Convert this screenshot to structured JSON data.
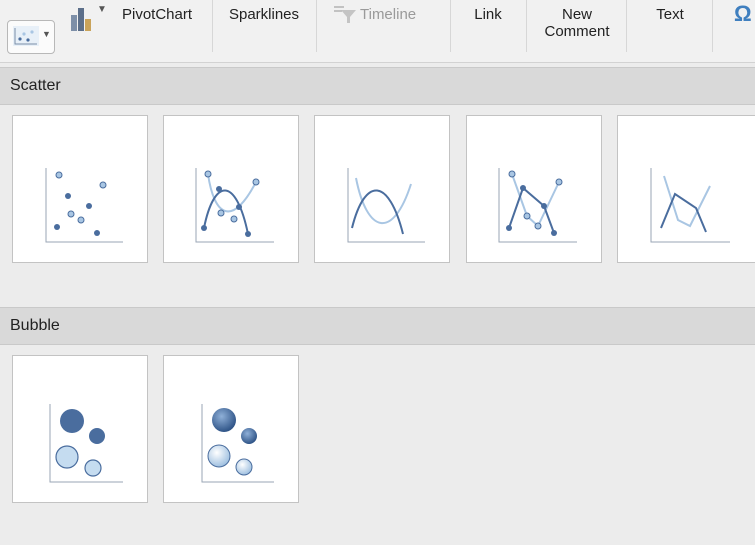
{
  "ribbon": {
    "pivotchart_label": "PivotChart",
    "sparklines_label": "Sparklines",
    "timeline_label": "Timeline",
    "link_label": "Link",
    "new_comment_line1": "New",
    "new_comment_line2": "Comment",
    "text_label": "Text"
  },
  "sections": {
    "scatter": {
      "title": "Scatter",
      "options": [
        {
          "icon": "scatter-markers-only-icon"
        },
        {
          "icon": "scatter-smooth-lines-markers-icon"
        },
        {
          "icon": "scatter-smooth-lines-icon"
        },
        {
          "icon": "scatter-straight-lines-markers-icon"
        },
        {
          "icon": "scatter-straight-lines-icon"
        }
      ]
    },
    "bubble": {
      "title": "Bubble",
      "options": [
        {
          "icon": "bubble-icon"
        },
        {
          "icon": "bubble-3d-icon"
        }
      ]
    }
  },
  "colors": {
    "accent_dark": "#4a6d9e",
    "accent_light": "#a9c6e3",
    "tile_bg": "#ffffff",
    "panel_bg": "#ececec",
    "header_bg": "#d9d9d9"
  }
}
